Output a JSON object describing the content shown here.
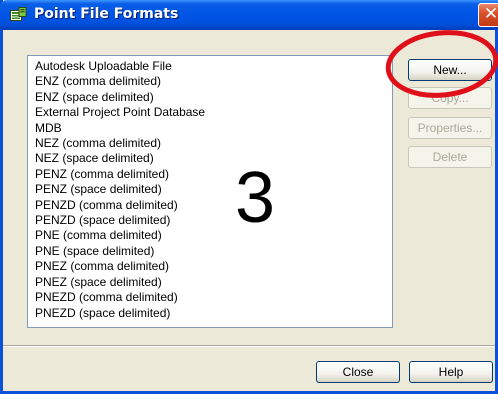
{
  "window": {
    "title": "Point File Formats",
    "close_glyph": "✕"
  },
  "formats_list": {
    "items": [
      "Autodesk Uploadable File",
      "ENZ (comma delimited)",
      "ENZ (space delimited)",
      "External Project Point Database",
      "MDB",
      "NEZ (comma delimited)",
      "NEZ (space delimited)",
      "PENZ (comma delimited)",
      "PENZ (space delimited)",
      "PENZD (comma delimited)",
      "PENZD (space delimited)",
      "PNE (comma delimited)",
      "PNE (space delimited)",
      "PNEZ (comma delimited)",
      "PNEZ (space delimited)",
      "PNEZD (comma delimited)",
      "PNEZD (space delimited)"
    ]
  },
  "side_buttons": {
    "new_label": "New...",
    "copy_label": "Copy...",
    "properties_label": "Properties...",
    "delete_label": "Delete"
  },
  "footer_buttons": {
    "close_label": "Close",
    "help_label": "Help"
  },
  "annotation": {
    "step_number": "3",
    "highlight_color": "#E0101A"
  },
  "icons": {
    "title_icon": "point-file-formats-icon",
    "close_icon": "close-icon"
  }
}
